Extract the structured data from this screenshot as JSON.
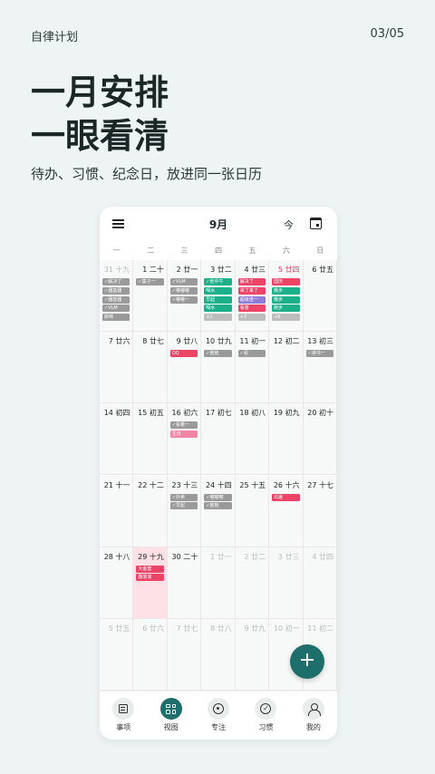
{
  "top": {
    "app_name": "自律计划",
    "page": "03/05"
  },
  "headline": {
    "line1": "一月安排",
    "line2": "一眼看清"
  },
  "subline": "待办、习惯、纪念日，放进同一张日历",
  "calendar": {
    "month": "9月",
    "today_label": "今",
    "weekdays": [
      "一",
      "二",
      "三",
      "四",
      "五",
      "六",
      "日"
    ],
    "days": [
      {
        "d": "31",
        "l": "十九",
        "faded": true,
        "events": [
          {
            "t": "✓解决了",
            "c": "grey"
          },
          {
            "t": "✓器基器",
            "c": "grey"
          },
          {
            "t": "✓器基器",
            "c": "grey"
          },
          {
            "t": "✓VLM",
            "c": "grey"
          },
          {
            "t": "颠倒",
            "c": "grey"
          }
        ]
      },
      {
        "d": "1",
        "l": "二十",
        "events": [
          {
            "t": "✓集子一",
            "c": "grey"
          }
        ]
      },
      {
        "d": "2",
        "l": "廿一",
        "events": [
          {
            "t": "✓VLM",
            "c": "grey"
          },
          {
            "t": "✓嘟嘟嘟",
            "c": "grey"
          },
          {
            "t": "✓嘟嘟一",
            "c": "grey"
          }
        ]
      },
      {
        "d": "3",
        "l": "廿二",
        "events": [
          {
            "t": "✓他中午",
            "c": "green"
          },
          {
            "t": "喝水",
            "c": "green"
          },
          {
            "t": "早起",
            "c": "green"
          },
          {
            "t": "喝水",
            "c": "green"
          },
          {
            "t": "+2",
            "c": "more"
          }
        ]
      },
      {
        "d": "4",
        "l": "廿三",
        "events": [
          {
            "t": "解决了",
            "c": "red"
          },
          {
            "t": "来了来了",
            "c": "red"
          },
          {
            "t": "超级连一",
            "c": "purple"
          },
          {
            "t": "看着",
            "c": "red"
          },
          {
            "t": "+7",
            "c": "more"
          }
        ]
      },
      {
        "d": "5",
        "l": "廿四",
        "red": true,
        "events": [
          {
            "t": "国庆",
            "c": "red"
          },
          {
            "t": "散步",
            "c": "green"
          },
          {
            "t": "散步",
            "c": "green"
          },
          {
            "t": "跑步",
            "c": "green"
          },
          {
            "t": "+6",
            "c": "more"
          }
        ]
      },
      {
        "d": "6",
        "l": "廿五",
        "events": []
      },
      {
        "d": "7",
        "l": "廿六",
        "events": []
      },
      {
        "d": "8",
        "l": "廿七",
        "events": []
      },
      {
        "d": "9",
        "l": "廿八",
        "events": [
          {
            "t": "QQ",
            "c": "red"
          }
        ]
      },
      {
        "d": "10",
        "l": "廿九",
        "events": [
          {
            "t": "✓拖拖",
            "c": "grey"
          }
        ]
      },
      {
        "d": "11",
        "l": "初一",
        "events": [
          {
            "t": "✓看",
            "c": "grey"
          }
        ]
      },
      {
        "d": "12",
        "l": "初二",
        "events": []
      },
      {
        "d": "13",
        "l": "初三",
        "events": [
          {
            "t": "✓读书一",
            "c": "grey"
          }
        ]
      },
      {
        "d": "14",
        "l": "初四",
        "events": []
      },
      {
        "d": "15",
        "l": "初五",
        "events": []
      },
      {
        "d": "16",
        "l": "初六",
        "events": [
          {
            "t": "✓看着一",
            "c": "grey"
          },
          {
            "t": "生日",
            "c": "pink"
          }
        ]
      },
      {
        "d": "17",
        "l": "初七",
        "events": []
      },
      {
        "d": "18",
        "l": "初八",
        "events": []
      },
      {
        "d": "19",
        "l": "初九",
        "events": []
      },
      {
        "d": "20",
        "l": "初十",
        "events": []
      },
      {
        "d": "21",
        "l": "十一",
        "events": []
      },
      {
        "d": "22",
        "l": "十二",
        "events": []
      },
      {
        "d": "23",
        "l": "十三",
        "events": [
          {
            "t": "✓外卖",
            "c": "grey"
          },
          {
            "t": "✓早起",
            "c": "grey"
          }
        ]
      },
      {
        "d": "24",
        "l": "十四",
        "events": [
          {
            "t": "✓嘟嘟嘟",
            "c": "grey"
          },
          {
            "t": "✓拖拖",
            "c": "grey"
          }
        ]
      },
      {
        "d": "25",
        "l": "十五",
        "events": []
      },
      {
        "d": "26",
        "l": "十六",
        "events": [
          {
            "t": "出差",
            "c": "red"
          }
        ]
      },
      {
        "d": "27",
        "l": "十七",
        "events": []
      },
      {
        "d": "28",
        "l": "十八",
        "events": []
      },
      {
        "d": "29",
        "l": "十九",
        "today": true,
        "events": [
          {
            "t": "大客套",
            "c": "red"
          },
          {
            "t": "翻滚滚",
            "c": "red"
          }
        ]
      },
      {
        "d": "30",
        "l": "二十",
        "events": []
      },
      {
        "d": "1",
        "l": "廿一",
        "faded": true,
        "events": []
      },
      {
        "d": "2",
        "l": "廿二",
        "faded": true,
        "events": []
      },
      {
        "d": "3",
        "l": "廿三",
        "faded": true,
        "events": []
      },
      {
        "d": "4",
        "l": "廿四",
        "faded": true,
        "events": []
      },
      {
        "d": "5",
        "l": "廿五",
        "faded": true,
        "events": []
      },
      {
        "d": "6",
        "l": "廿六",
        "faded": true,
        "events": []
      },
      {
        "d": "7",
        "l": "廿七",
        "faded": true,
        "events": []
      },
      {
        "d": "8",
        "l": "廿八",
        "faded": true,
        "events": []
      },
      {
        "d": "9",
        "l": "廿九",
        "faded": true,
        "events": []
      },
      {
        "d": "10",
        "l": "初一",
        "faded": true,
        "events": []
      },
      {
        "d": "11",
        "l": "初二",
        "faded": true,
        "events": []
      }
    ]
  },
  "fab": {
    "label": "+",
    "icon": "plus-icon"
  },
  "tabs": [
    {
      "label": "事项",
      "icon": "list-icon"
    },
    {
      "label": "视图",
      "icon": "grid-icon",
      "active": true
    },
    {
      "label": "专注",
      "icon": "target-icon"
    },
    {
      "label": "习惯",
      "icon": "check-circle-icon"
    },
    {
      "label": "我的",
      "icon": "user-icon"
    }
  ],
  "colors": {
    "accent": "#1e6e6b",
    "red": "#eb4466",
    "green": "#1bb08a",
    "purple": "#8f7bd8",
    "pink": "#f285a6",
    "grey": "#9a9a9a",
    "today_bg": "#fde1e6"
  }
}
